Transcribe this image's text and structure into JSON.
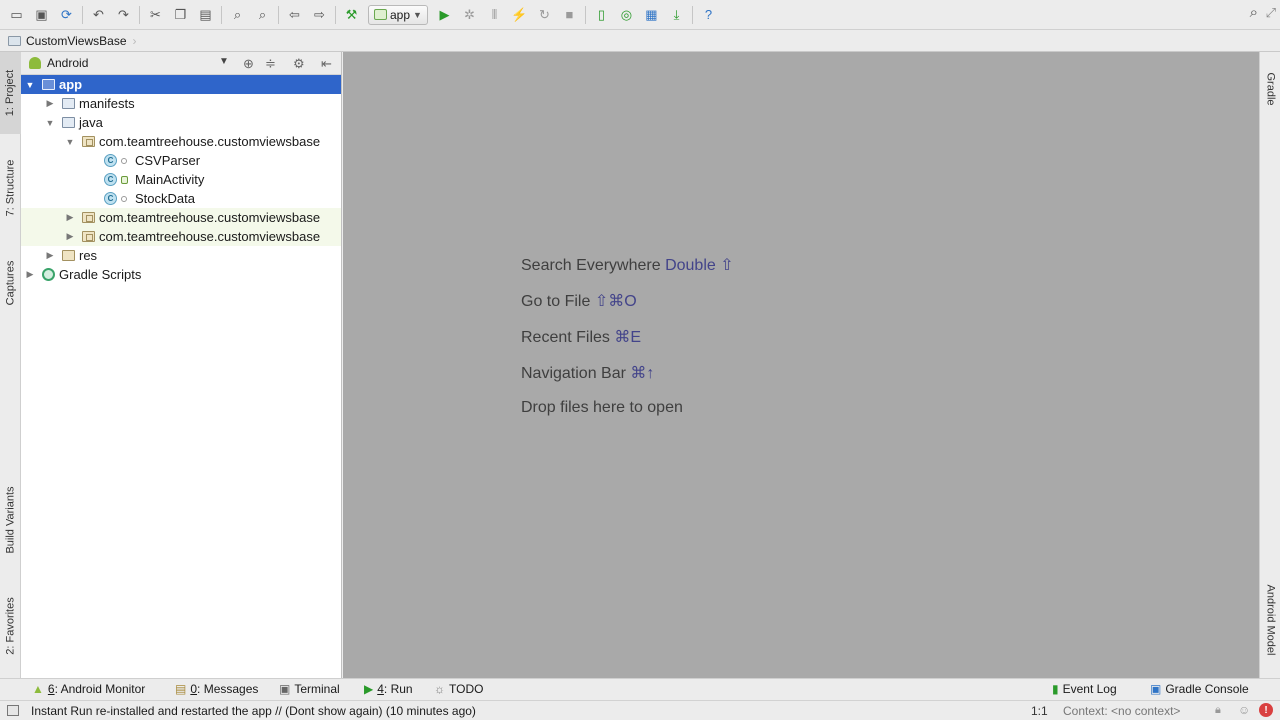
{
  "toolbar": {
    "run_config": "app",
    "icons": [
      "open-icon",
      "save-icon",
      "sync-icon",
      "undo-icon",
      "redo-icon",
      "cut-icon",
      "copy-icon",
      "paste-icon",
      "find-icon",
      "replace-icon",
      "back-icon",
      "forward-icon",
      "make-project-icon",
      "run-icon",
      "debug-icon",
      "attach-debugger-icon",
      "apply-changes-icon",
      "rerun-icon",
      "stop-icon",
      "avd-manager-icon",
      "sync-gradle-icon",
      "project-structure-icon",
      "sdk-manager-icon",
      "help-icon",
      "search-everywhere-icon"
    ]
  },
  "breadcrumb": {
    "project": "CustomViewsBase"
  },
  "left_tabs": {
    "project": "1: Project",
    "structure": "7: Structure",
    "captures": "Captures",
    "build_variants": "Build Variants",
    "favorites": "2: Favorites"
  },
  "right_tabs": {
    "gradle": "Gradle",
    "android_model": "Android Model"
  },
  "project_panel": {
    "view": "Android",
    "tree": {
      "app": "app",
      "manifests": "manifests",
      "java": "java",
      "pkg_main": "com.teamtreehouse.customviewsbase",
      "class1": "CSVParser",
      "class2": "MainActivity",
      "class3": "StockData",
      "pkg_test1": "com.teamtreehouse.customviewsbase",
      "pkg_test2": "com.teamtreehouse.customviewsbase",
      "res": "res",
      "gradle_scripts": "Gradle Scripts"
    },
    "class_badge": "C"
  },
  "editor": {
    "hints": [
      {
        "label": "Search Everywhere",
        "key": "Double ⇧"
      },
      {
        "label": "Go to File",
        "key": "⇧⌘O"
      },
      {
        "label": "Recent Files",
        "key": "⌘E"
      },
      {
        "label": "Navigation Bar",
        "key": "⌘↑"
      },
      {
        "label": "Drop files here to open",
        "key": ""
      }
    ]
  },
  "bottom_bar": {
    "android_monitor": {
      "num": "6",
      "label": ": Android Monitor"
    },
    "messages": {
      "num": "0",
      "label": ": Messages"
    },
    "terminal": "Terminal",
    "run": {
      "num": "4",
      "label": ": Run"
    },
    "todo": "TODO",
    "event_log": "Event Log",
    "gradle_console": "Gradle Console"
  },
  "status_bar": {
    "message": "Instant Run re-installed and restarted the app // (Dont show again) (10 minutes ago)",
    "position": "1:1",
    "context": "Context: <no context>",
    "error_badge": "!"
  }
}
